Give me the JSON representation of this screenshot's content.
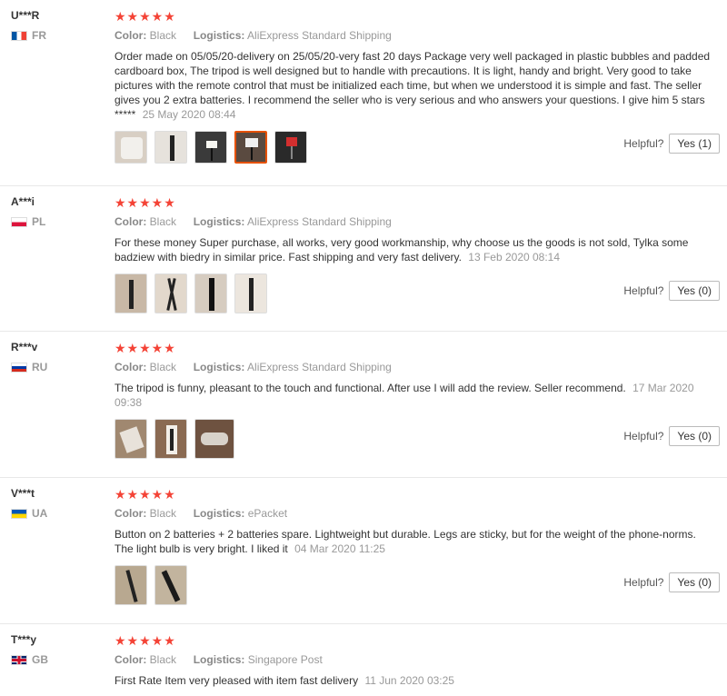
{
  "reviews": [
    {
      "user": "U***R",
      "country": "FR",
      "stars": "★★★★★",
      "color_label": "Color:",
      "color_value": "Black",
      "logistics_label": "Logistics:",
      "logistics_value": "AliExpress Standard Shipping",
      "text": "Order made on 05/05/20-delivery on 25/05/20-very fast 20 days Package very well packaged in plastic bubbles and padded cardboard box, The tripod is well designed but to handle with precautions. It is light, handy and bright. Very good to take pictures with the remote control that must be initialized each time, but when we understood it is simple and fast. The seller gives you 2 extra batteries. I recommend the seller who is very serious and who answers your questions. I give him 5 stars *****",
      "date": "25 May 2020 08:44",
      "helpful_label": "Helpful?",
      "yes_label": "Yes (1)",
      "photo_count": 5
    },
    {
      "user": "A***i",
      "country": "PL",
      "stars": "★★★★★",
      "color_label": "Color:",
      "color_value": "Black",
      "logistics_label": "Logistics:",
      "logistics_value": "AliExpress Standard Shipping",
      "text": "For these money Super purchase, all works, very good workmanship, why choose us the goods is not sold, Tylka some badziew with biedry in similar price. Fast shipping and very fast delivery.",
      "date": "13 Feb 2020 08:14",
      "helpful_label": "Helpful?",
      "yes_label": "Yes (0)",
      "photo_count": 4
    },
    {
      "user": "R***v",
      "country": "RU",
      "stars": "★★★★★",
      "color_label": "Color:",
      "color_value": "Black",
      "logistics_label": "Logistics:",
      "logistics_value": "AliExpress Standard Shipping",
      "text": "The tripod is funny, pleasant to the touch and functional. After use I will add the review. Seller recommend.",
      "date": "17 Mar 2020 09:38",
      "helpful_label": "Helpful?",
      "yes_label": "Yes (0)",
      "photo_count": 3
    },
    {
      "user": "V***t",
      "country": "UA",
      "stars": "★★★★★",
      "color_label": "Color:",
      "color_value": "Black",
      "logistics_label": "Logistics:",
      "logistics_value": "ePacket",
      "text": "Button on 2 batteries + 2 batteries spare. Lightweight but durable. Legs are sticky, but for the weight of the phone-norms. The light bulb is very bright. I liked it",
      "date": "04 Mar 2020 11:25",
      "helpful_label": "Helpful?",
      "yes_label": "Yes (0)",
      "photo_count": 2
    },
    {
      "user": "T***y",
      "country": "GB",
      "stars": "★★★★★",
      "color_label": "Color:",
      "color_value": "Black",
      "logistics_label": "Logistics:",
      "logistics_value": "Singapore Post",
      "text": "First Rate Item very pleased with item fast delivery",
      "date": "11 Jun 2020 03:25"
    }
  ]
}
